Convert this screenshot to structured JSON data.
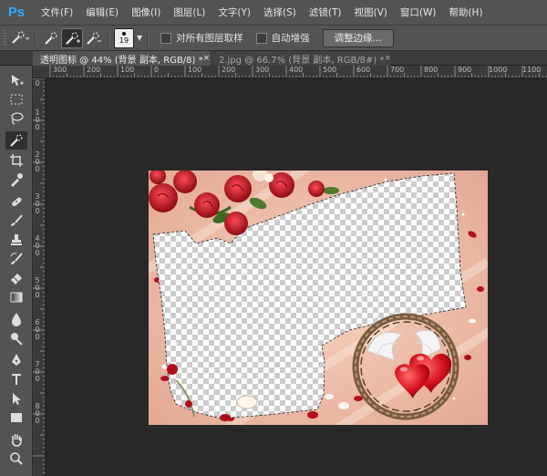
{
  "app": {
    "logo_text": "Ps"
  },
  "menu": [
    "文件(F)",
    "编辑(E)",
    "图像(I)",
    "图层(L)",
    "文字(Y)",
    "选择(S)",
    "滤镜(T)",
    "视图(V)",
    "窗口(W)",
    "帮助(H)"
  ],
  "options": {
    "brush_size": "19",
    "sample_all_layers": "对所有图层取样",
    "auto_enhance": "自动增强",
    "refine_edge": "调整边缘..."
  },
  "tabs": [
    {
      "label": "透明图标 @ 44% (背景 副本, RGB/8) *",
      "close": "×"
    },
    {
      "label": "2.jpg @ 66.7% (背景 副本, RGB/8#) *",
      "close": "×"
    }
  ],
  "ruler_top": [
    "300",
    "200",
    "100",
    "0",
    "100",
    "200",
    "300",
    "400",
    "500",
    "600",
    "700",
    "800",
    "900",
    "1000",
    "1100"
  ],
  "ruler_left": [
    "0",
    "1 0 0",
    "2 0 0",
    "3 0 0",
    "4 0 0",
    "5 0 0",
    "6 0 0",
    "7 0 0",
    "8 0 0"
  ],
  "colors": {
    "ui_panel": "#535353",
    "workspace": "#282828",
    "accent_logo": "#31a8ff",
    "canvas_peach": "#f0bfa8",
    "rose_red": "#c8102e"
  },
  "tools": [
    "move-icon",
    "marquee-icon",
    "lasso-icon",
    "quick-selection-icon",
    "crop-icon",
    "eyedropper-icon",
    "healing-icon",
    "brush-icon",
    "stamp-icon",
    "history-brush-icon",
    "eraser-icon",
    "gradient-icon",
    "blur-icon",
    "dodge-icon",
    "pen-icon",
    "type-icon",
    "path-select-icon",
    "shape-icon",
    "hand-icon",
    "zoom-icon"
  ]
}
